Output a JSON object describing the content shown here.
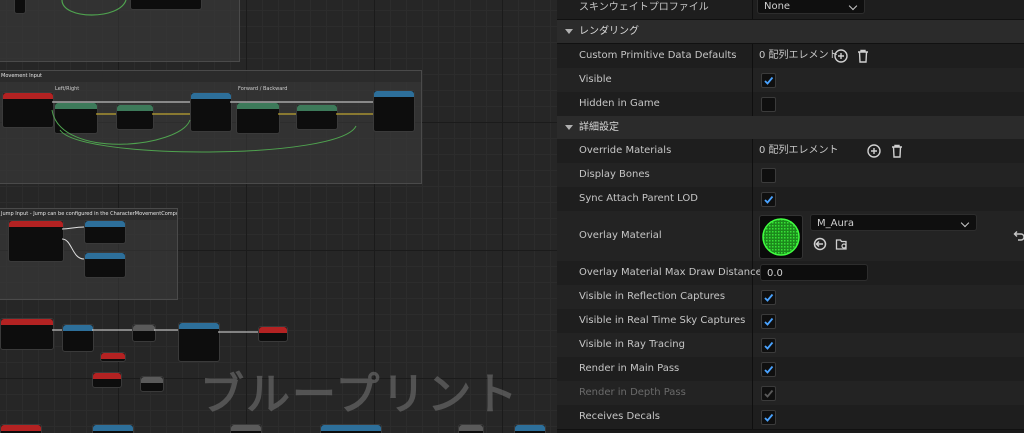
{
  "graph": {
    "comment_movement": "Movement Input",
    "label_leftright": "Left/Right",
    "label_forward": "Forward / Backward",
    "comment_jump": "Jump Input - Jump can be configured in the CharacterMovementComponent",
    "watermark": "ブループリント"
  },
  "panel": {
    "skin_weight_label": "スキンウェイトプロファイル",
    "skin_weight_value": "None",
    "categories": {
      "rendering": "レンダリング",
      "advanced": "詳細設定"
    },
    "custom_primitive": {
      "label": "Custom Primitive Data Defaults",
      "value": "0 配列エレメント"
    },
    "visible": {
      "label": "Visible",
      "checked": true
    },
    "hidden_in_game": {
      "label": "Hidden in Game",
      "checked": false
    },
    "override_materials": {
      "label": "Override Materials",
      "value": "0 配列エレメント"
    },
    "display_bones": {
      "label": "Display Bones",
      "checked": false
    },
    "sync_attach": {
      "label": "Sync Attach Parent LOD",
      "checked": true
    },
    "overlay_material": {
      "label": "Overlay Material",
      "value": "M_Aura"
    },
    "overlay_max_draw": {
      "label": "Overlay Material Max Draw Distance",
      "value": "0.0"
    },
    "vis_reflection": {
      "label": "Visible in Reflection Captures",
      "checked": true
    },
    "vis_sky": {
      "label": "Visible in Real Time Sky Captures",
      "checked": true
    },
    "vis_raytracing": {
      "label": "Visible in Ray Tracing",
      "checked": true
    },
    "render_main": {
      "label": "Render in Main Pass",
      "checked": true
    },
    "render_depth": {
      "label": "Render in Depth Pass",
      "checked": true,
      "disabled": true
    },
    "receives_decals": {
      "label": "Receives Decals",
      "checked": true
    }
  },
  "colors": {
    "accent_check": "#4aa3ff",
    "material_thumb": "#2fd12f"
  }
}
